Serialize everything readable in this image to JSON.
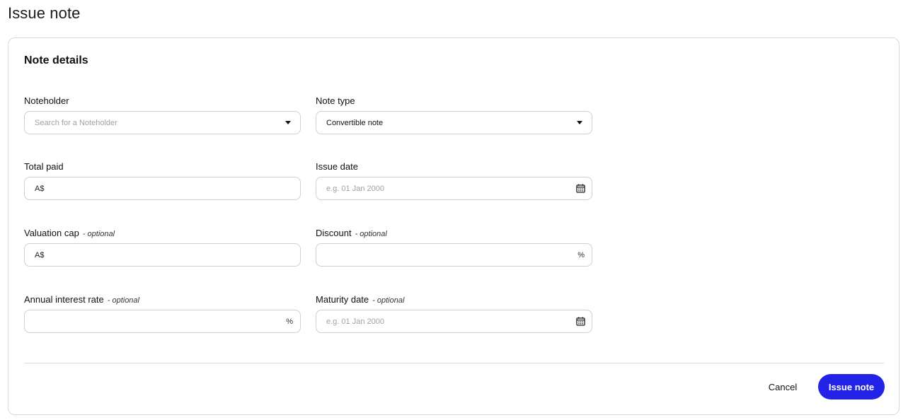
{
  "page": {
    "title": "Issue note"
  },
  "card": {
    "title": "Note details"
  },
  "fields": {
    "noteholder": {
      "label": "Noteholder",
      "placeholder": "Search for a Noteholder",
      "icon": "chevron-down-icon"
    },
    "note_type": {
      "label": "Note type",
      "value": "Convertible note",
      "icon": "chevron-down-icon"
    },
    "total_paid": {
      "label": "Total paid",
      "prefix": "A$",
      "value": ""
    },
    "issue_date": {
      "label": "Issue date",
      "placeholder": "e.g. 01 Jan 2000",
      "icon": "calendar-icon"
    },
    "valuation_cap": {
      "label": "Valuation cap",
      "optional": "- optional",
      "prefix": "A$",
      "value": ""
    },
    "discount": {
      "label": "Discount",
      "optional": "- optional",
      "suffix": "%",
      "value": ""
    },
    "annual_interest_rate": {
      "label": "Annual interest rate",
      "optional": "- optional",
      "suffix": "%",
      "value": ""
    },
    "maturity_date": {
      "label": "Maturity date",
      "optional": "- optional",
      "placeholder": "e.g. 01 Jan 2000",
      "icon": "calendar-icon"
    }
  },
  "actions": {
    "cancel_label": "Cancel",
    "submit_label": "Issue note"
  },
  "colors": {
    "primary": "#2323e8",
    "border": "#cfcfd4",
    "placeholder": "#a0a0a8"
  }
}
